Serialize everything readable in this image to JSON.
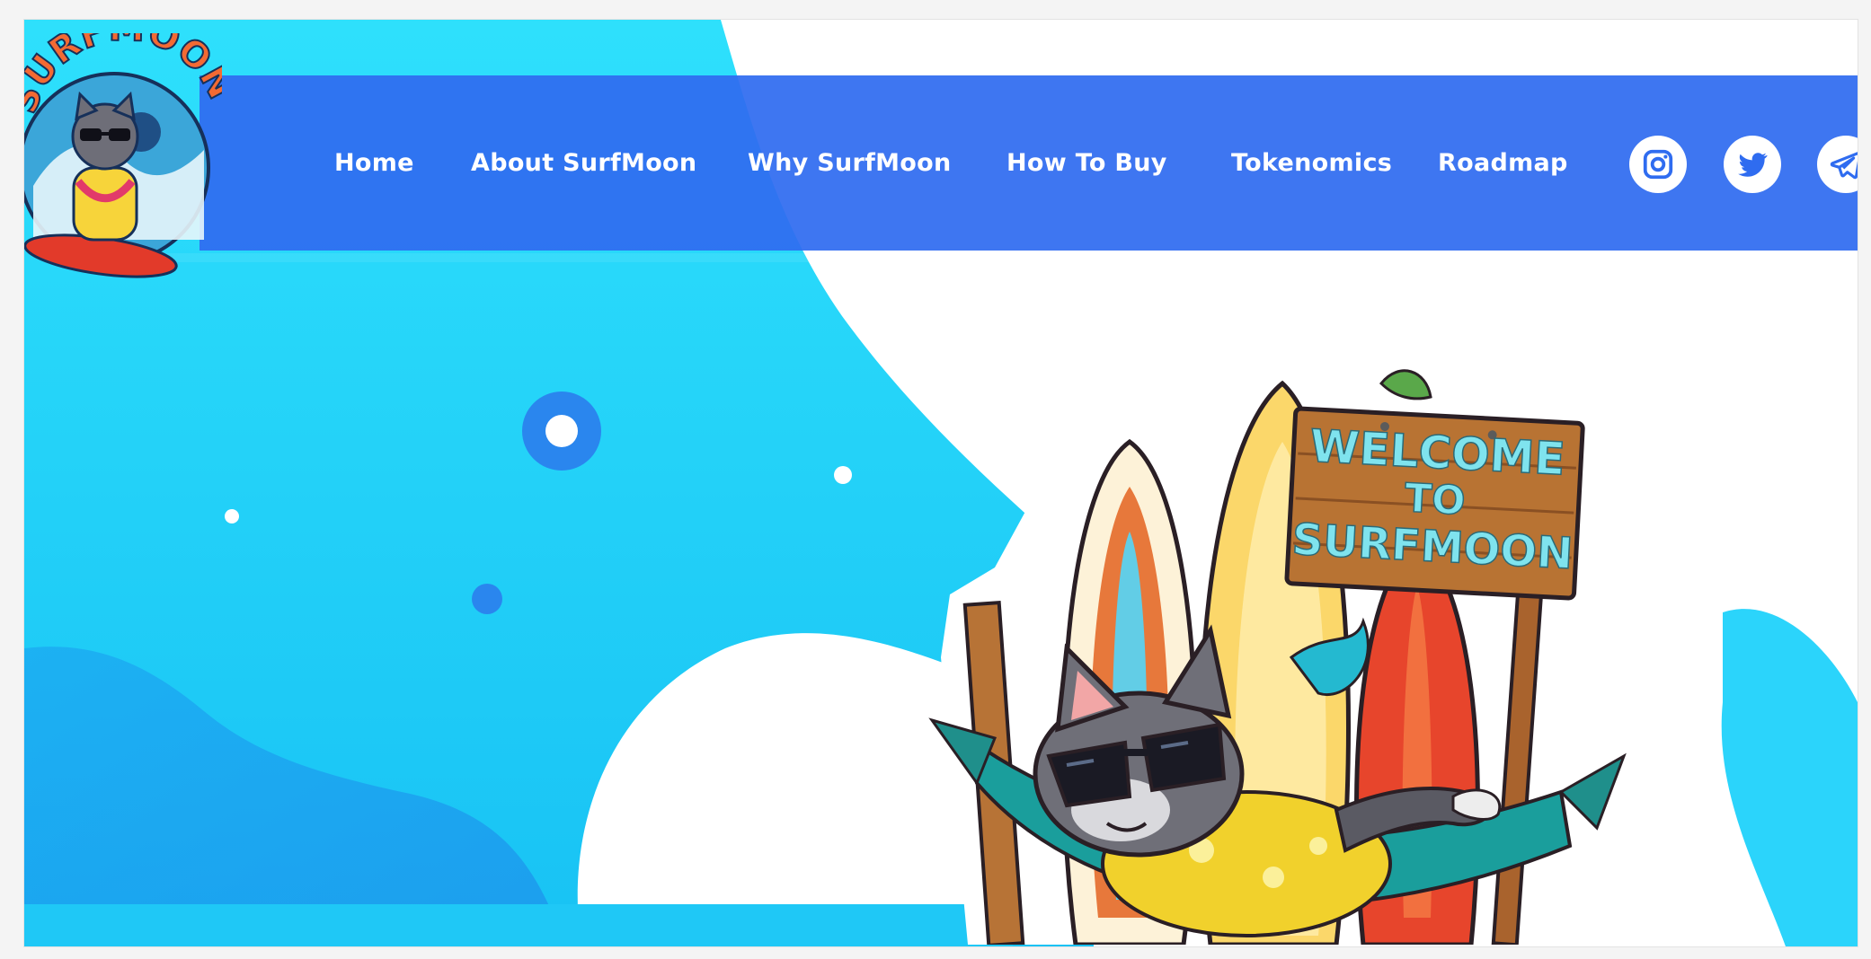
{
  "brand": {
    "logo_text": "SURFMOON"
  },
  "nav": {
    "items": [
      {
        "label": "Home"
      },
      {
        "label": "About SurfMoon"
      },
      {
        "label": "Why SurfMoon"
      },
      {
        "label": "How To Buy"
      },
      {
        "label": "Tokenomics"
      },
      {
        "label": "Roadmap"
      }
    ]
  },
  "social": [
    {
      "icon": "instagram-icon"
    },
    {
      "icon": "twitter-icon"
    },
    {
      "icon": "telegram-icon"
    }
  ],
  "hero": {
    "sign_lines": [
      "WELCOME",
      "TO",
      "SURFMOON"
    ]
  },
  "colors": {
    "nav_blue": "#2f6cf0",
    "sky_cyan": "#28d2fb",
    "deep_blue": "#1e80ee",
    "white": "#ffffff"
  }
}
